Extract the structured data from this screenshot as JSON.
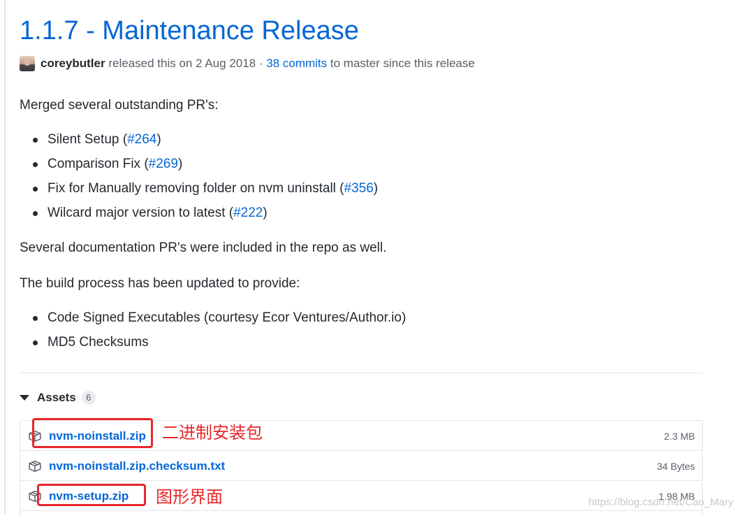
{
  "release": {
    "title": "1.1.7 - Maintenance Release",
    "author": "coreybutler",
    "released_text": "released this on 2 Aug 2018 ·",
    "commits_link": "38 commits",
    "commits_suffix": "to master since this release"
  },
  "notes": {
    "intro": "Merged several outstanding PR's:",
    "prs": [
      {
        "text": "Silent Setup (",
        "link": "#264",
        "close": ")"
      },
      {
        "text": "Comparison Fix (",
        "link": "#269",
        "close": ")"
      },
      {
        "text": "Fix for Manually removing folder on nvm uninstall (",
        "link": "#356",
        "close": ")"
      },
      {
        "text": "Wilcard major version to latest (",
        "link": "#222",
        "close": ")"
      }
    ],
    "docs_line": "Several documentation PR's were included in the repo as well.",
    "build_line": "The build process has been updated to provide:",
    "build_items": [
      "Code Signed Executables (courtesy Ecor Ventures/Author.io)",
      "MD5 Checksums"
    ]
  },
  "assets": {
    "label": "Assets",
    "count": "6",
    "items": [
      {
        "name": "nvm-noinstall.zip",
        "size": "2.3 MB"
      },
      {
        "name": "nvm-noinstall.zip.checksum.txt",
        "size": "34 Bytes"
      },
      {
        "name": "nvm-setup.zip",
        "size": "1.98 MB"
      }
    ]
  },
  "annotations": {
    "binary_package": "二进制安装包",
    "gui": "图形界面"
  },
  "watermark": "https://blog.csdn.net/Cao_Mary",
  "colors": {
    "link": "#0366d6",
    "annotation_red": "#e8262a"
  }
}
